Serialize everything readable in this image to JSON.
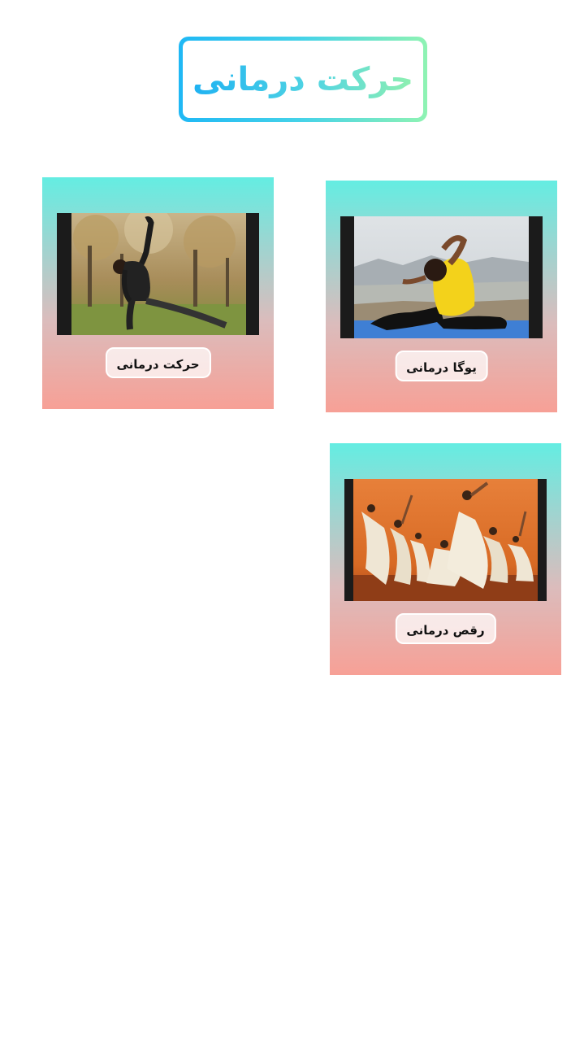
{
  "header": {
    "title": "حرکت درمانی"
  },
  "cards": [
    {
      "label": "یوگا درمانی",
      "image": "yoga-pose-photo"
    },
    {
      "label": "حرکت درمانی",
      "image": "outdoor-stretch-photo"
    },
    {
      "label": "رقص درمانی",
      "image": "dance-troupe-photo"
    }
  ],
  "colors": {
    "title_gradient_start": "#1fb2f2",
    "title_gradient_end": "#8ff0b0",
    "card_gradient_top": "#64ede2",
    "card_gradient_bottom": "#f7a096"
  }
}
